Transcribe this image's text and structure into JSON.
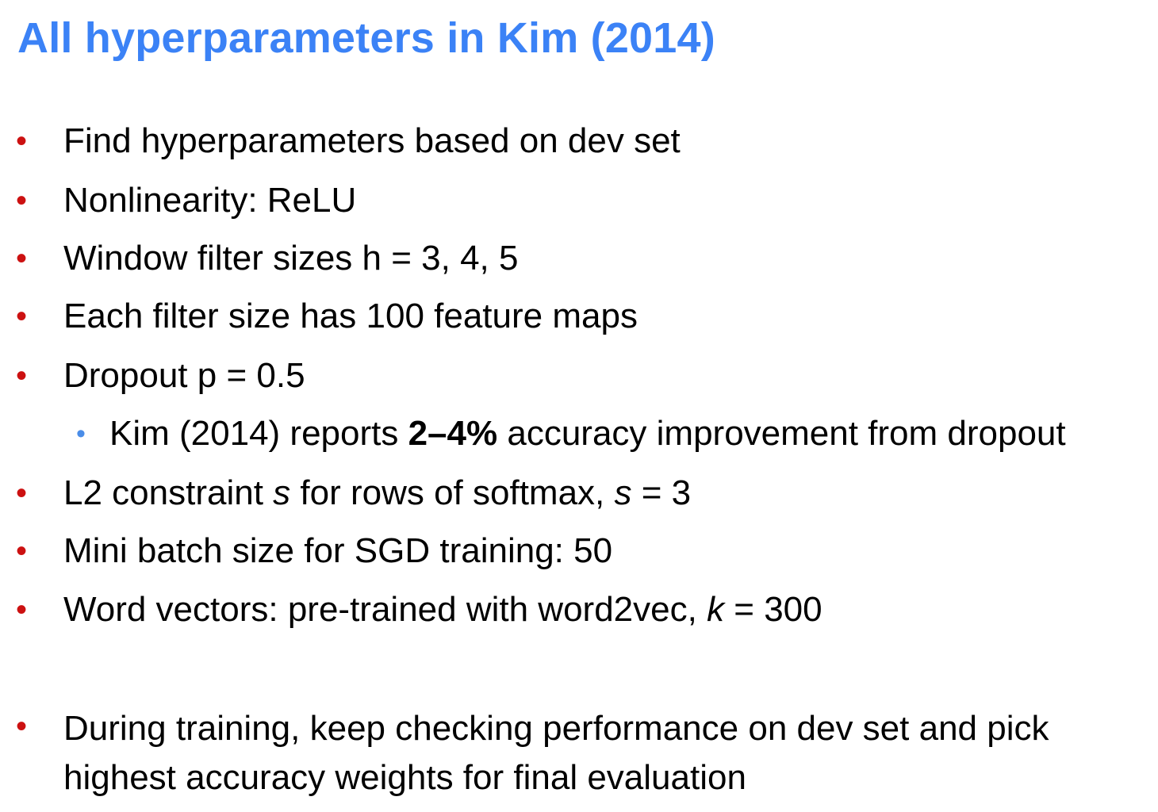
{
  "slide": {
    "title": "All hyperparameters in Kim (2014)",
    "bullet_glyph": "•",
    "sub_bullet_glyph": "•",
    "colors": {
      "title": "#3b82f6",
      "bullet": "#cc1111",
      "sub_bullet": "#4a8de8",
      "text": "#000000"
    },
    "items": [
      {
        "text": "Find hyperparameters based on dev set"
      },
      {
        "text": "Nonlinearity: ReLU"
      },
      {
        "text": "Window filter sizes h = 3, 4, 5"
      },
      {
        "text": "Each filter size has 100 feature maps"
      },
      {
        "text": "Dropout p = 0.5"
      },
      {
        "pre": "Kim (2014) reports ",
        "bold": "2–4%",
        "post": " accuracy improvement from dropout"
      },
      {
        "pre": "L2 constraint ",
        "ital1": "s",
        "mid": " for rows of softmax, ",
        "ital2": "s",
        "post": " = 3"
      },
      {
        "text": "Mini batch size for SGD training: 50"
      },
      {
        "pre": "Word vectors: pre-trained with word2vec, ",
        "ital": "k",
        "post": " = 300"
      },
      {
        "line1": "During training, keep checking performance on dev set and pick",
        "line2": "highest accuracy weights for final evaluation"
      }
    ]
  }
}
